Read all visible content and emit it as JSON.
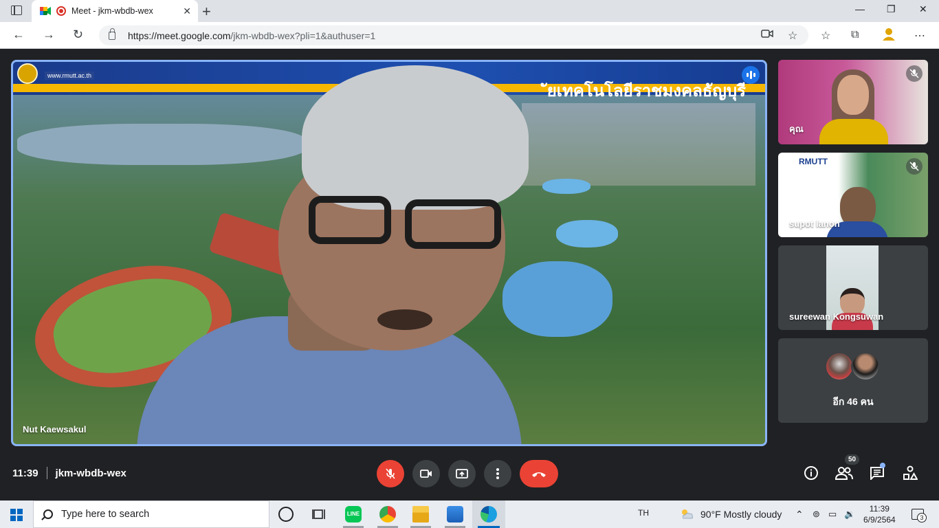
{
  "browser": {
    "tab_title": "Meet - jkm-wbdb-wex",
    "url_main": "https://meet.google.com",
    "url_rest": "/jkm-wbdb-wex?pli=1&authuser=1"
  },
  "meeting": {
    "time": "11:39",
    "code": "jkm-wbdb-wex",
    "participants_count": "50"
  },
  "main_tile": {
    "name": "Nut Kaewsakul",
    "banner_title": "ัยเทคโนโลยีราชมงคลธัญบุรี",
    "banner_web": "www.rmutt.ac.th"
  },
  "side_tiles": [
    {
      "name": "คุณ",
      "muted": true
    },
    {
      "name": "supot lanon",
      "muted": true
    },
    {
      "name": "sureewan Kongsuwan",
      "muted": false
    }
  ],
  "more_tile": {
    "label": "อีก 46 คน"
  },
  "taskbar": {
    "search_placeholder": "Type here to search",
    "lang": "TH",
    "weather": "90°F  Mostly cloudy",
    "clock_time": "11:39",
    "clock_date": "6/9/2564",
    "notifications": "3"
  },
  "colors": {
    "meet_bg": "#202124",
    "end_call": "#ea4335",
    "speaking_border": "#8ab4f8",
    "taskbar_accent": "#0067c0"
  }
}
